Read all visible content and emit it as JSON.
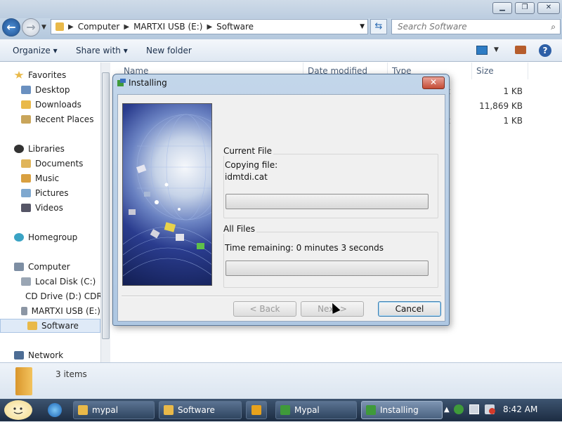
{
  "window": {
    "minimize_glyph": "▁",
    "maximize_glyph": "❐",
    "close_glyph": "✕"
  },
  "address_bar": {
    "back_glyph": "←",
    "forward_glyph": "→",
    "path": [
      "Computer",
      "MARTXI USB (E:)",
      "Software"
    ],
    "refresh_glyph": "⇆",
    "search_placeholder": "Search Software",
    "search_glyph": "⌕"
  },
  "toolbar": {
    "organize": "Organize ▾",
    "share_with": "Share with ▾",
    "new_folder": "New folder",
    "help_glyph": "?"
  },
  "nav_pane": {
    "favorites": {
      "label": "Favorites",
      "items": [
        "Desktop",
        "Downloads",
        "Recent Places"
      ]
    },
    "libraries": {
      "label": "Libraries",
      "items": [
        "Documents",
        "Music",
        "Pictures",
        "Videos"
      ]
    },
    "homegroup": "Homegroup",
    "computer": {
      "label": "Computer",
      "items": [
        "Local Disk (C:)",
        "CD Drive (D:) CDR",
        "MARTXI USB (E:)",
        "Software"
      ]
    },
    "network": "Network"
  },
  "file_list": {
    "columns": [
      "Name",
      "Date modified",
      "Type",
      "Size"
    ],
    "rows": [
      {
        "type_partial": "t",
        "size": "1 KB"
      },
      {
        "type_partial": "",
        "size": "11,869 KB"
      },
      {
        "type_partial": "t",
        "size": "1 KB"
      }
    ]
  },
  "details_pane": {
    "items_count": "3 items"
  },
  "dialog": {
    "title": "Installing",
    "close_glyph": "✕",
    "current_file_group": "Current File",
    "copying_label": "Copying file:",
    "current_file_name": "idmtdi.cat",
    "current_progress": 0,
    "all_files_group": "All Files",
    "time_remaining": "Time remaining: 0 minutes 3 seconds",
    "all_progress": 0,
    "buttons": {
      "back": "< Back",
      "next": "Next >",
      "cancel": "Cancel"
    }
  },
  "taskbar": {
    "buttons": [
      {
        "label": "mypal"
      },
      {
        "label": "Software"
      },
      {
        "label": ""
      },
      {
        "label": "Mypal"
      },
      {
        "label": "Installing"
      }
    ],
    "clock": "8:42 AM"
  },
  "colors": {
    "accent": "#2b6bb3",
    "folder": "#e9b949",
    "progress_fill": "#33b52e"
  }
}
